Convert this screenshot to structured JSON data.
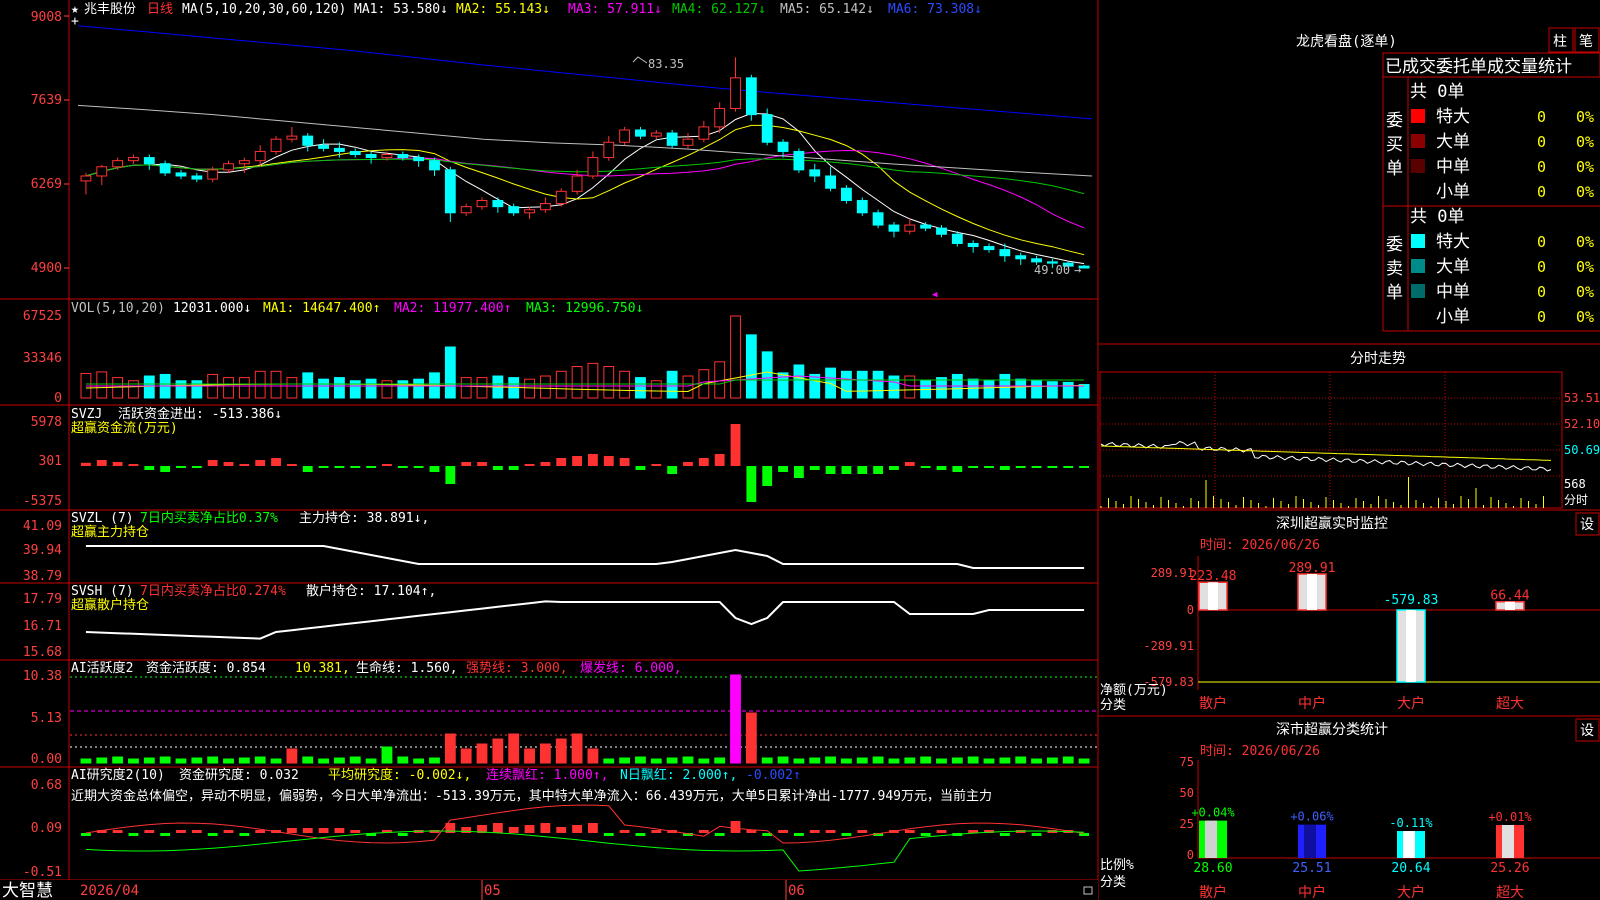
{
  "app": {
    "name": "大智慧"
  },
  "stock": {
    "name": "兆丰股份",
    "period": "日线"
  },
  "colors": {
    "up": "#ff3232",
    "down": "#00ffff",
    "bg": "#000000",
    "border": "#c80000",
    "ma1": "#ffffff",
    "ma2": "#ffff00",
    "ma3": "#ff00ff",
    "ma4": "#00c800",
    "ma5": "#c0c0c0",
    "ma6": "#0000ff",
    "green": "#00ff00",
    "axis": "#ff4040"
  },
  "main": {
    "header": {
      "star": "★",
      "ma_label": "MA(5,10,20,30,60,120)",
      "ma1": "MA1: 53.580↓",
      "ma2": "MA2: 55.143↓",
      "ma3": "MA3: 57.911↓",
      "ma4": "MA4: 62.127↓",
      "ma5": "MA5: 65.142↓",
      "ma6": "MA6: 73.308↓"
    },
    "yticks": [
      "9008",
      "7639",
      "6269",
      "4900"
    ],
    "high_label": "83.35",
    "low_label": "49.00"
  },
  "vol": {
    "header": {
      "label": "VOL(5,10,20)",
      "value": "12031.000↓",
      "ma1": "MA1: 14647.400↑",
      "ma2": "MA2: 11977.400↑",
      "ma3": "MA3: 12996.750↓"
    },
    "yticks": [
      "67525",
      "33346",
      "0"
    ]
  },
  "svzj": {
    "header": {
      "label": "SVZJ",
      "value": "活跃资金进出: -513.386↓"
    },
    "subtitle": "超赢资金流(万元)",
    "yticks": [
      "5978",
      "301",
      "-5375"
    ]
  },
  "svzl": {
    "header": {
      "label": "SVZL (7)",
      "share": "7日内买卖净占比0.37%",
      "value": "主力持仓: 38.891↓,"
    },
    "subtitle": "超赢主力持仓",
    "yticks": [
      "41.09",
      "39.94",
      "38.79"
    ]
  },
  "svsh": {
    "header": {
      "label": "SVSH (7)",
      "share": "7日内买卖净占比0.274%",
      "value": "散户持仓: 17.104↑,"
    },
    "subtitle": "超赢散户持仓",
    "yticks": [
      "17.79",
      "16.71",
      "15.68"
    ]
  },
  "aihy": {
    "header": {
      "label": "AI活跃度2",
      "v1": "资金活跃度: 0.854",
      "v2": "10.381,",
      "v3": "生命线: 1.560,",
      "v4": "强势线: 3.000,",
      "v5": "爆发线: 6.000,"
    },
    "yticks": [
      "10.38",
      "5.13",
      "0.00"
    ]
  },
  "aiyj": {
    "header": {
      "label": "AI研究度2(10)",
      "v1": "资金研究度: 0.032",
      "v2": "平均研究度: -0.002↓,",
      "v3": "连续飘红: 1.000↑,",
      "v4": "N日飘红: 2.000↑,",
      "v5": "-0.002↑"
    },
    "comment": "近期大资金总体偏空，异动不明显，偏弱势，今日大单净流出：-513.39万元，其中特大单净流入：66.439万元，大单5日累计净出-1777.949万元，当前主力",
    "yticks": [
      "0.68",
      "0.09",
      "-0.51"
    ]
  },
  "xaxis": {
    "labels": [
      "2026/04",
      "05",
      "06"
    ]
  },
  "right": {
    "lhb": {
      "title": "龙虎看盘(逐单)",
      "btn1": "柱",
      "btn2": "笔",
      "subtitle": "已成交委托单成交量统计",
      "buy": {
        "side": "委买单",
        "total": "共 0单",
        "rows": [
          {
            "label": "特大",
            "count": "0",
            "pct": "0%",
            "color": "#ff0000"
          },
          {
            "label": "大单",
            "count": "0",
            "pct": "0%",
            "color": "#8b0000"
          },
          {
            "label": "中单",
            "count": "0",
            "pct": "0%",
            "color": "#5a0000"
          },
          {
            "label": "小单",
            "count": "0",
            "pct": "0%",
            "color": ""
          }
        ]
      },
      "sell": {
        "side": "委卖单",
        "total": "共 0单",
        "rows": [
          {
            "label": "特大",
            "count": "0",
            "pct": "0%",
            "color": "#00ffff"
          },
          {
            "label": "大单",
            "count": "0",
            "pct": "0%",
            "color": "#008b8b"
          },
          {
            "label": "中单",
            "count": "0",
            "pct": "0%",
            "color": "#006b6b"
          },
          {
            "label": "小单",
            "count": "0",
            "pct": "0%",
            "color": ""
          }
        ]
      }
    },
    "fs": {
      "title": "分时走势",
      "yticks": [
        "53.51",
        "52.10",
        "50.69"
      ],
      "vol_label": "568",
      "unit": "分时"
    },
    "monitor": {
      "title": "深圳超赢实时监控",
      "btn": "设",
      "time": "时间: 2026/06/26",
      "ylabel": "净额(万元)",
      "xtitle": "分类",
      "yticks": [
        "289.91",
        "0",
        "-289.91",
        "-579.83"
      ],
      "categories": [
        "散户",
        "中户",
        "大户",
        "超大"
      ],
      "values": [
        223.48,
        289.91,
        -579.83,
        66.44
      ],
      "labels": [
        "223.48",
        "289.91",
        "-579.83",
        "66.44"
      ]
    },
    "classify": {
      "title": "深市超赢分类统计",
      "btn": "设",
      "time": "时间: 2026/06/26",
      "ylabel": "比例%",
      "xtitle": "分类",
      "yticks": [
        "75",
        "50",
        "25",
        "0"
      ],
      "categories": [
        "散户",
        "中户",
        "大户",
        "超大"
      ],
      "values": [
        28.6,
        25.51,
        20.64,
        25.26
      ],
      "labels": [
        "28.60",
        "25.51",
        "20.64",
        "25.26"
      ],
      "changes": [
        "+0.04%",
        "+0.06%",
        "-0.11%",
        "+0.01%"
      ]
    }
  },
  "chart_data": [
    {
      "type": "candlestick",
      "title": "兆丰股份 日线",
      "ylim": [
        49.0,
        90.08
      ],
      "yticks": [
        90.08,
        76.39,
        62.69,
        49.0
      ],
      "high": 83.35,
      "low": 49.0,
      "ohlc": [
        [
          63.2,
          64.0,
          61.0,
          64.5
        ],
        [
          64.0,
          65.5,
          62.5,
          65.8
        ],
        [
          65.5,
          66.5,
          65.0,
          67.0
        ],
        [
          66.5,
          67.0,
          66.0,
          67.5
        ],
        [
          67.0,
          66.0,
          65.0,
          67.5
        ],
        [
          66.0,
          64.5,
          64.0,
          66.5
        ],
        [
          64.5,
          64.0,
          63.5,
          65.0
        ],
        [
          64.0,
          63.5,
          63.0,
          64.5
        ],
        [
          63.5,
          65.0,
          63.0,
          65.5
        ],
        [
          65.0,
          66.0,
          64.5,
          66.5
        ],
        [
          66.0,
          66.5,
          64.5,
          67.0
        ],
        [
          66.5,
          68.0,
          65.5,
          69.0
        ],
        [
          68.0,
          70.0,
          67.5,
          70.5
        ],
        [
          70.0,
          70.5,
          69.5,
          72.0
        ],
        [
          70.5,
          69.0,
          68.0,
          71.0
        ],
        [
          69.0,
          68.5,
          68.0,
          70.0
        ],
        [
          68.5,
          68.0,
          67.0,
          69.5
        ],
        [
          68.0,
          67.5,
          67.0,
          68.5
        ],
        [
          67.5,
          67.0,
          66.0,
          68.0
        ],
        [
          67.0,
          67.5,
          66.5,
          68.0
        ],
        [
          67.5,
          67.0,
          66.5,
          68.0
        ],
        [
          67.0,
          66.5,
          65.5,
          67.5
        ],
        [
          66.5,
          65.0,
          64.0,
          67.0
        ],
        [
          65.0,
          58.0,
          56.5,
          65.5
        ],
        [
          58.0,
          59.0,
          57.5,
          59.5
        ],
        [
          59.0,
          60.0,
          58.5,
          60.5
        ],
        [
          60.0,
          59.0,
          58.0,
          60.5
        ],
        [
          59.0,
          58.0,
          57.5,
          59.5
        ],
        [
          58.0,
          58.5,
          57.0,
          59.0
        ],
        [
          58.5,
          59.5,
          58.0,
          60.5
        ],
        [
          59.5,
          61.5,
          59.0,
          62.0
        ],
        [
          61.5,
          64.0,
          61.0,
          65.0
        ],
        [
          64.0,
          67.0,
          63.5,
          68.0
        ],
        [
          67.0,
          69.5,
          66.5,
          70.5
        ],
        [
          69.5,
          71.5,
          69.0,
          72.0
        ],
        [
          71.5,
          70.5,
          70.0,
          72.0
        ],
        [
          70.5,
          71.0,
          70.0,
          71.5
        ],
        [
          71.0,
          69.0,
          68.5,
          71.5
        ],
        [
          69.0,
          70.0,
          68.5,
          71.0
        ],
        [
          70.0,
          72.0,
          69.5,
          73.0
        ],
        [
          72.0,
          75.0,
          71.0,
          76.0
        ],
        [
          75.0,
          80.0,
          74.5,
          83.35
        ],
        [
          80.0,
          74.0,
          73.0,
          80.5
        ],
        [
          74.0,
          69.5,
          69.0,
          75.0
        ],
        [
          69.5,
          68.0,
          67.0,
          70.0
        ],
        [
          68.0,
          65.0,
          64.5,
          68.5
        ],
        [
          65.0,
          64.0,
          63.0,
          66.0
        ],
        [
          64.0,
          62.0,
          61.5,
          65.5
        ],
        [
          62.0,
          60.0,
          59.5,
          62.5
        ],
        [
          60.0,
          58.0,
          57.5,
          60.5
        ],
        [
          58.0,
          56.0,
          55.5,
          58.5
        ],
        [
          56.0,
          55.0,
          54.0,
          56.5
        ],
        [
          55.0,
          56.0,
          54.5,
          57.0
        ],
        [
          56.0,
          55.5,
          55.0,
          56.5
        ],
        [
          55.5,
          54.5,
          54.0,
          56.0
        ],
        [
          54.5,
          53.0,
          52.5,
          55.0
        ],
        [
          53.0,
          52.5,
          51.5,
          53.5
        ],
        [
          52.5,
          52.0,
          51.5,
          53.0
        ],
        [
          52.0,
          51.0,
          50.0,
          53.0
        ],
        [
          51.0,
          50.5,
          49.5,
          51.5
        ],
        [
          50.5,
          50.0,
          49.5,
          51.0
        ],
        [
          50.0,
          49.8,
          49.0,
          50.5
        ],
        [
          49.8,
          49.3,
          49.0,
          50.0
        ],
        [
          49.3,
          49.0,
          49.0,
          49.5
        ]
      ],
      "series": [
        {
          "name": "MA1",
          "last": 53.58
        },
        {
          "name": "MA2",
          "last": 55.143
        },
        {
          "name": "MA3",
          "last": 57.911
        },
        {
          "name": "MA4",
          "last": 62.127
        },
        {
          "name": "MA5",
          "last": 65.142
        },
        {
          "name": "MA6",
          "last": 73.308
        }
      ]
    },
    {
      "type": "bar",
      "title": "VOL(5,10,20)",
      "ylim": [
        0,
        67525
      ],
      "last": 12031
    },
    {
      "type": "bar",
      "title": "深圳超赢实时监控",
      "categories": [
        "散户",
        "中户",
        "大户",
        "超大"
      ],
      "values": [
        223.48,
        289.91,
        -579.83,
        66.44
      ],
      "ylim": [
        -579.83,
        289.91
      ]
    },
    {
      "type": "bar",
      "title": "深市超赢分类统计",
      "categories": [
        "散户",
        "中户",
        "大户",
        "超大"
      ],
      "values": [
        28.6,
        25.51,
        20.64,
        25.26
      ],
      "ylim": [
        0,
        75
      ]
    }
  ]
}
